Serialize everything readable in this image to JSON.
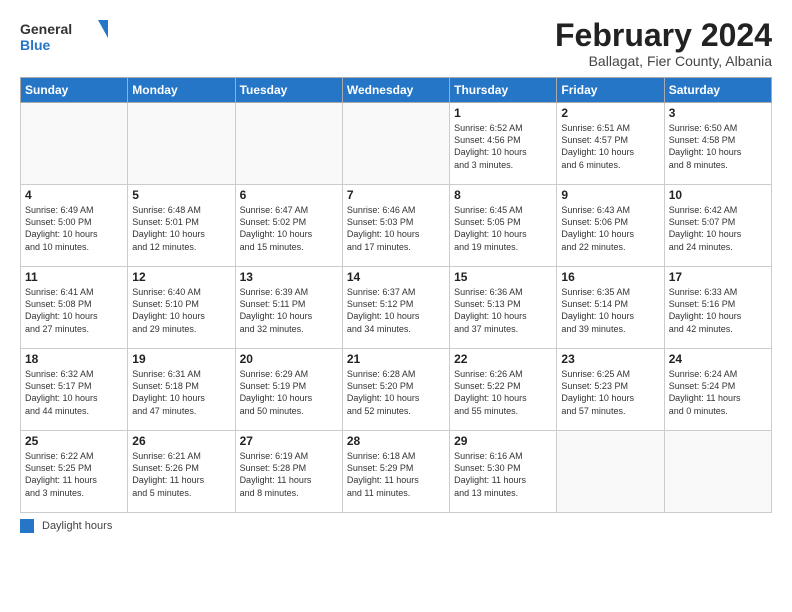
{
  "logo": {
    "general": "General",
    "blue": "Blue"
  },
  "header": {
    "month": "February 2024",
    "location": "Ballagat, Fier County, Albania"
  },
  "days_of_week": [
    "Sunday",
    "Monday",
    "Tuesday",
    "Wednesday",
    "Thursday",
    "Friday",
    "Saturday"
  ],
  "weeks": [
    [
      {
        "day": "",
        "info": ""
      },
      {
        "day": "",
        "info": ""
      },
      {
        "day": "",
        "info": ""
      },
      {
        "day": "",
        "info": ""
      },
      {
        "day": "1",
        "info": "Sunrise: 6:52 AM\nSunset: 4:56 PM\nDaylight: 10 hours\nand 3 minutes."
      },
      {
        "day": "2",
        "info": "Sunrise: 6:51 AM\nSunset: 4:57 PM\nDaylight: 10 hours\nand 6 minutes."
      },
      {
        "day": "3",
        "info": "Sunrise: 6:50 AM\nSunset: 4:58 PM\nDaylight: 10 hours\nand 8 minutes."
      }
    ],
    [
      {
        "day": "4",
        "info": "Sunrise: 6:49 AM\nSunset: 5:00 PM\nDaylight: 10 hours\nand 10 minutes."
      },
      {
        "day": "5",
        "info": "Sunrise: 6:48 AM\nSunset: 5:01 PM\nDaylight: 10 hours\nand 12 minutes."
      },
      {
        "day": "6",
        "info": "Sunrise: 6:47 AM\nSunset: 5:02 PM\nDaylight: 10 hours\nand 15 minutes."
      },
      {
        "day": "7",
        "info": "Sunrise: 6:46 AM\nSunset: 5:03 PM\nDaylight: 10 hours\nand 17 minutes."
      },
      {
        "day": "8",
        "info": "Sunrise: 6:45 AM\nSunset: 5:05 PM\nDaylight: 10 hours\nand 19 minutes."
      },
      {
        "day": "9",
        "info": "Sunrise: 6:43 AM\nSunset: 5:06 PM\nDaylight: 10 hours\nand 22 minutes."
      },
      {
        "day": "10",
        "info": "Sunrise: 6:42 AM\nSunset: 5:07 PM\nDaylight: 10 hours\nand 24 minutes."
      }
    ],
    [
      {
        "day": "11",
        "info": "Sunrise: 6:41 AM\nSunset: 5:08 PM\nDaylight: 10 hours\nand 27 minutes."
      },
      {
        "day": "12",
        "info": "Sunrise: 6:40 AM\nSunset: 5:10 PM\nDaylight: 10 hours\nand 29 minutes."
      },
      {
        "day": "13",
        "info": "Sunrise: 6:39 AM\nSunset: 5:11 PM\nDaylight: 10 hours\nand 32 minutes."
      },
      {
        "day": "14",
        "info": "Sunrise: 6:37 AM\nSunset: 5:12 PM\nDaylight: 10 hours\nand 34 minutes."
      },
      {
        "day": "15",
        "info": "Sunrise: 6:36 AM\nSunset: 5:13 PM\nDaylight: 10 hours\nand 37 minutes."
      },
      {
        "day": "16",
        "info": "Sunrise: 6:35 AM\nSunset: 5:14 PM\nDaylight: 10 hours\nand 39 minutes."
      },
      {
        "day": "17",
        "info": "Sunrise: 6:33 AM\nSunset: 5:16 PM\nDaylight: 10 hours\nand 42 minutes."
      }
    ],
    [
      {
        "day": "18",
        "info": "Sunrise: 6:32 AM\nSunset: 5:17 PM\nDaylight: 10 hours\nand 44 minutes."
      },
      {
        "day": "19",
        "info": "Sunrise: 6:31 AM\nSunset: 5:18 PM\nDaylight: 10 hours\nand 47 minutes."
      },
      {
        "day": "20",
        "info": "Sunrise: 6:29 AM\nSunset: 5:19 PM\nDaylight: 10 hours\nand 50 minutes."
      },
      {
        "day": "21",
        "info": "Sunrise: 6:28 AM\nSunset: 5:20 PM\nDaylight: 10 hours\nand 52 minutes."
      },
      {
        "day": "22",
        "info": "Sunrise: 6:26 AM\nSunset: 5:22 PM\nDaylight: 10 hours\nand 55 minutes."
      },
      {
        "day": "23",
        "info": "Sunrise: 6:25 AM\nSunset: 5:23 PM\nDaylight: 10 hours\nand 57 minutes."
      },
      {
        "day": "24",
        "info": "Sunrise: 6:24 AM\nSunset: 5:24 PM\nDaylight: 11 hours\nand 0 minutes."
      }
    ],
    [
      {
        "day": "25",
        "info": "Sunrise: 6:22 AM\nSunset: 5:25 PM\nDaylight: 11 hours\nand 3 minutes."
      },
      {
        "day": "26",
        "info": "Sunrise: 6:21 AM\nSunset: 5:26 PM\nDaylight: 11 hours\nand 5 minutes."
      },
      {
        "day": "27",
        "info": "Sunrise: 6:19 AM\nSunset: 5:28 PM\nDaylight: 11 hours\nand 8 minutes."
      },
      {
        "day": "28",
        "info": "Sunrise: 6:18 AM\nSunset: 5:29 PM\nDaylight: 11 hours\nand 11 minutes."
      },
      {
        "day": "29",
        "info": "Sunrise: 6:16 AM\nSunset: 5:30 PM\nDaylight: 11 hours\nand 13 minutes."
      },
      {
        "day": "",
        "info": ""
      },
      {
        "day": "",
        "info": ""
      }
    ]
  ],
  "legend": {
    "box_color": "#2576c7",
    "label": "Daylight hours"
  }
}
